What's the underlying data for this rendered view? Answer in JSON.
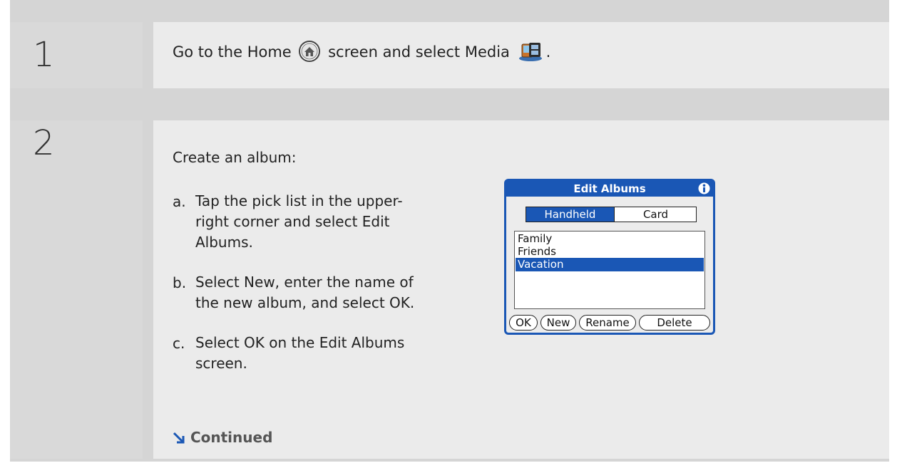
{
  "step1": {
    "number": "1",
    "text_before": "Go to the Home",
    "text_middle": "screen and select Media",
    "text_after": ".",
    "home_icon": "home-icon",
    "media_icon": "media-icon"
  },
  "step2": {
    "number": "2",
    "intro": "Create an album:",
    "items": [
      {
        "marker": "a.",
        "lines": [
          "Tap the pick list in the upper-",
          "right corner and select Edit",
          "Albums."
        ]
      },
      {
        "marker": "b.",
        "lines": [
          "Select New, enter the name of",
          "the new album, and select OK."
        ]
      },
      {
        "marker": "c.",
        "lines": [
          "Select OK on the Edit Albums",
          "screen."
        ]
      }
    ],
    "continued": "Continued"
  },
  "device": {
    "title": "Edit Albums",
    "tabs": [
      "Handheld",
      "Card"
    ],
    "selected_tab": "Handheld",
    "albums": [
      "Family",
      "Friends",
      "Vacation"
    ],
    "selected_album": "Vacation",
    "buttons": [
      "OK",
      "New",
      "Rename",
      "Delete"
    ]
  },
  "colors": {
    "accent": "#1a57b5",
    "panel_bg": "#d5d5d5",
    "content_bg": "#ebebeb"
  }
}
